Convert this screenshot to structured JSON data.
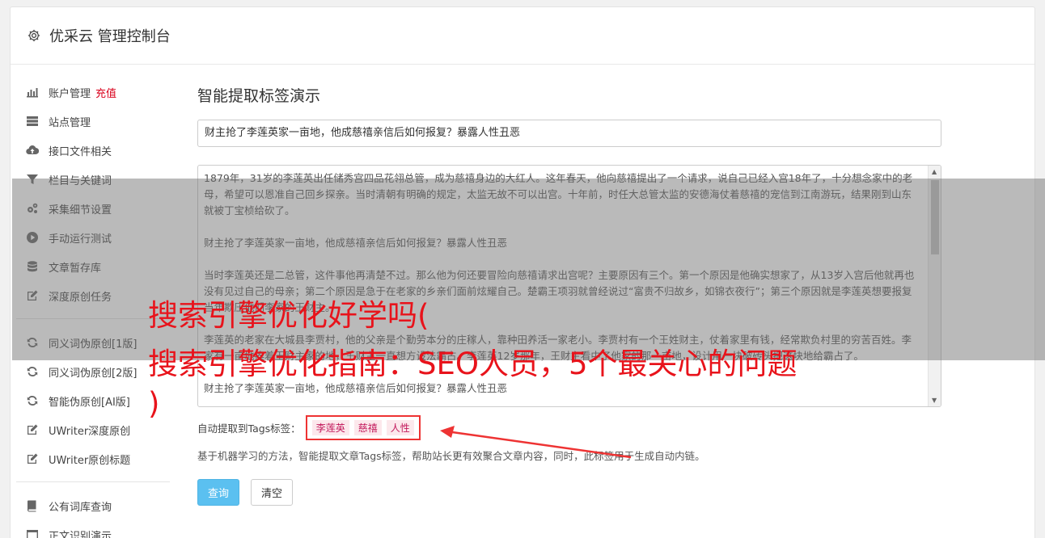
{
  "header": {
    "title": "优采云 管理控制台"
  },
  "sidebar": {
    "items": [
      {
        "label": "账户管理",
        "extra": "充值",
        "icon": "bar-chart-icon"
      },
      {
        "label": "站点管理",
        "icon": "server-icon"
      },
      {
        "label": "接口文件相关",
        "icon": "cloud-upload-icon"
      },
      {
        "label": "栏目与关键词",
        "icon": "filter-icon"
      },
      {
        "label": "采集细节设置",
        "icon": "gears-icon"
      },
      {
        "label": "手动运行测试",
        "icon": "play-circle-icon"
      },
      {
        "label": "文章暂存库",
        "icon": "database-icon"
      },
      {
        "label": "深度原创任务",
        "icon": "edit-icon"
      }
    ],
    "items2": [
      {
        "label": "同义词伪原创[1版]",
        "icon": "refresh-icon"
      },
      {
        "label": "同义词伪原创[2版]",
        "icon": "refresh-icon"
      },
      {
        "label": "智能伪原创[AI版]",
        "icon": "refresh-icon"
      },
      {
        "label": "UWriter深度原创",
        "icon": "edit-icon"
      },
      {
        "label": "UWriter原创标题",
        "icon": "edit-icon"
      }
    ],
    "items3": [
      {
        "label": "公有词库查询",
        "icon": "book-icon"
      },
      {
        "label": "正文识别演示",
        "icon": "window-icon"
      }
    ]
  },
  "main": {
    "title": "智能提取标签演示",
    "title_input": "财主抢了李莲英家一亩地，他成慈禧亲信后如何报复？暴露人性丑恶",
    "paragraphs": [
      "1879年，31岁的李莲英出任储秀宫四品花翎总管，成为慈禧身边的大红人。这年春天，他向慈禧提出了一个请求，说自己已经入宫18年了，十分想念家中的老母，希望可以恩准自己回乡探亲。当时清朝有明确的规定，太监无故不可以出宫。十年前，时任大总管太监的安德海仗着慈禧的宠信到江南游玩，结果刚到山东就被丁宝桢给砍了。",
      "财主抢了李莲英家一亩地，他成慈禧亲信后如何报复？暴露人性丑恶",
      "当时李莲英还是二总管，这件事他再清楚不过。那么他为何还要冒险向慈禧请求出宫呢？主要原因有三个。第一个原因是他确实想家了，从13岁入宫后他就再也没有见过自己的母亲；第二个原因是急于在老家的乡亲们面前炫耀自己。楚霸王项羽就曾经说过“富贵不归故乡，如锦衣夜行”；第三个原因就是李莲英想要报复当年欺压他们李家的王财主。",
      "李莲英的老家在大城县李贾村，他的父亲是个勤劳本分的庄稼人，靠种田养活一家老小。李贾村有一个王姓财主，仗着家里有钱，经常欺负村里的穷苦百姓。李家有一亩地挨着王财主家的地，王财主一直想方设法霸占。李莲英12岁那年，王财主看中了他家的那一亩地，设计用一块破砖头把这块地给霸占了。",
      "财主抢了李莲英家一亩地，他成慈禧亲信后如何报复？暴露人性丑恶"
    ],
    "tags_label": "自动提取到Tags标签：",
    "tags": [
      "李莲英",
      "慈禧",
      "人性"
    ],
    "description": "基于机器学习的方法，智能提取文章Tags标签，帮助站长更有效聚合文章内容，同时，此标签用于生成自动内链。",
    "query_button": "查询",
    "clear_button": "清空"
  },
  "overlay": {
    "line1": "搜索引擎优化好学吗(",
    "line2": "搜索引擎优化指南：SEO人员，5个最关心的问题",
    "line3": ")"
  },
  "colors": {
    "accent": "#5bc0f0",
    "overlay_text": "#e8131b",
    "tag_text": "#c2185b"
  }
}
